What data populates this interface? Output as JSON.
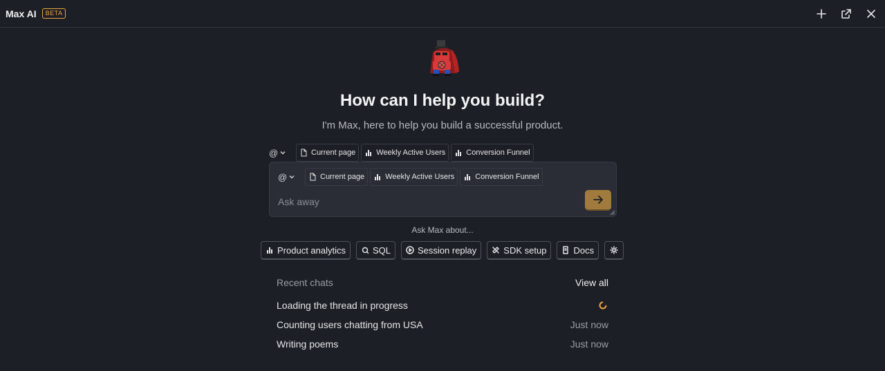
{
  "header": {
    "title": "Max AI",
    "badge": "BETA",
    "actions": [
      "new-chat-icon",
      "open-in-new-icon",
      "close-icon"
    ]
  },
  "hero": {
    "heading": "How can I help you build?",
    "subheading": "I'm Max, here to help you build a successful product."
  },
  "context_bar": {
    "trigger": "@",
    "chips": [
      {
        "icon": "document-icon",
        "label": "Current page"
      },
      {
        "icon": "bar-chart-icon",
        "label": "Weekly Active Users"
      },
      {
        "icon": "bar-chart-icon",
        "label": "Conversion Funnel"
      }
    ]
  },
  "input": {
    "placeholder": "Ask away",
    "value": ""
  },
  "suggestions": {
    "heading": "Ask Max about...",
    "items": [
      {
        "icon": "bar-chart-icon",
        "label": "Product analytics"
      },
      {
        "icon": "database-icon",
        "label": "SQL"
      },
      {
        "icon": "play-icon",
        "label": "Session replay"
      },
      {
        "icon": "plug-icon",
        "label": "SDK setup"
      },
      {
        "icon": "book-icon",
        "label": "Docs"
      }
    ],
    "settings_icon": "gear-icon"
  },
  "recent_chats": {
    "title": "Recent chats",
    "view_all": "View all",
    "items": [
      {
        "title": "Loading the thread in progress",
        "status": "loading"
      },
      {
        "title": "Counting users chatting from USA",
        "time": "Just now"
      },
      {
        "title": "Writing poems",
        "time": "Just now"
      }
    ]
  },
  "colors": {
    "background": "#1d1f27",
    "accent": "#f0a83c",
    "send_button": "#a17a3e"
  }
}
